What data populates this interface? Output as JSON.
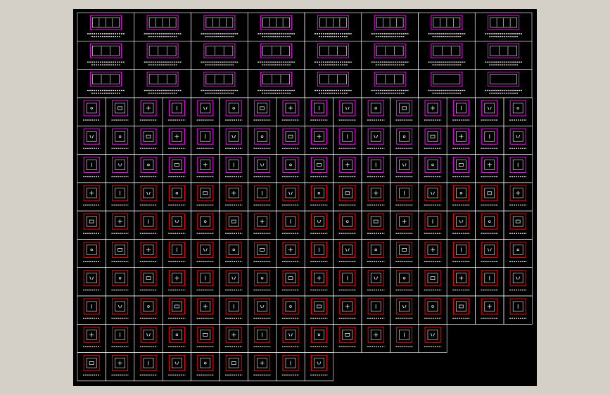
{
  "app": {
    "title": ""
  },
  "palette": {
    "background": "#000000",
    "grid": "#ffffff",
    "magenta": "#ff00ff",
    "red": "#ff0000",
    "label": "#ffffff"
  },
  "labels": [],
  "grid": {
    "rows": [
      {
        "kind": "wide",
        "count": 8,
        "frame": "magenta",
        "blank": []
      },
      {
        "kind": "wide",
        "count": 8,
        "frame": "magenta",
        "blank": []
      },
      {
        "kind": "wide",
        "count": 8,
        "frame": "magenta",
        "blank": [
          6,
          7
        ]
      },
      {
        "kind": "small",
        "count": 16,
        "frame": "magenta"
      },
      {
        "kind": "small",
        "count": 16,
        "frame": "magenta"
      },
      {
        "kind": "small",
        "count": 16,
        "frame": "magenta"
      },
      {
        "kind": "small",
        "count": 16,
        "frame": "red"
      },
      {
        "kind": "small",
        "count": 16,
        "frame": "red"
      },
      {
        "kind": "small",
        "count": 16,
        "frame": "red"
      },
      {
        "kind": "small",
        "count": 16,
        "frame": "red"
      },
      {
        "kind": "small",
        "count": 16,
        "frame": "red"
      },
      {
        "kind": "small",
        "count": 13,
        "frame": "red"
      },
      {
        "kind": "small",
        "count": 9,
        "frame": "red"
      }
    ]
  }
}
